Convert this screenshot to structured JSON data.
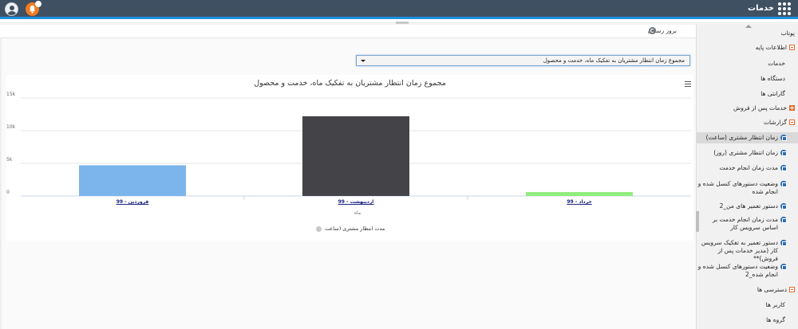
{
  "header": {
    "title": "خدمات",
    "notification_count": ""
  },
  "toolbar": {
    "refresh_label": "بروز رسانی"
  },
  "select": {
    "value": "مجموع زمان انتظار مشتریان به تفکیک ماه، خدمت و محصول"
  },
  "sidebar": {
    "items": [
      {
        "label": "پوتاب",
        "icon": ""
      },
      {
        "label": "اطلاعات پایه",
        "icon": "minus-box-icon"
      },
      {
        "label": "خدمات",
        "icon": ""
      },
      {
        "label": "دستگاه ها",
        "icon": ""
      },
      {
        "label": "گارانتی ها",
        "icon": ""
      },
      {
        "label": "خدمات پس از فروش",
        "icon": "plus-box-icon"
      },
      {
        "label": "گزارشات",
        "icon": "minus-box-icon"
      },
      {
        "label": "زمان انتظار مشتری (ساعت)",
        "icon": "report-icon"
      },
      {
        "label": "زمان انتظار مشتری (روز)",
        "icon": "report-icon"
      },
      {
        "label": "مدت زمان انجام خدمت",
        "icon": "report-icon"
      },
      {
        "label": "وضعیت دستورهای کنسل شده و انجام شده",
        "icon": "report-icon"
      },
      {
        "label": "دستور تعمیر های من_2",
        "icon": "report-icon"
      },
      {
        "label": "مدت زمان انجام خدمت بر اساس سرویس کار",
        "icon": "report-icon"
      },
      {
        "label": "دستور تعمیر به تفکیک سرویس کار (مدیر خدمات پس از فروش)**",
        "icon": "report-icon"
      },
      {
        "label": "وضعیت دستورهای کنسل شده و انجام شده_2",
        "icon": "report-icon"
      },
      {
        "label": "دسترسی ها",
        "icon": "minus-box-icon"
      },
      {
        "label": "کاربر ها",
        "icon": ""
      },
      {
        "label": "گروه ها",
        "icon": ""
      }
    ]
  },
  "colors": {
    "topbar": "#3f5062",
    "accent": "#1e90e0",
    "bell": "#f07b22"
  },
  "chart_data": {
    "type": "bar",
    "title": "مجموع زمان انتظار مشتریان به تفکیک ماه، خدمت و محصول",
    "xlabel": "ماه",
    "ylabel": "",
    "categories": [
      "فروردین - 99",
      "اردیبهشت - 99",
      "خرداد - 99"
    ],
    "values": [
      4700,
      12200,
      600
    ],
    "colors": [
      "#7cb5ec",
      "#434348",
      "#90ed7d"
    ],
    "ylim": [
      0,
      15000
    ],
    "yticks": [
      "0",
      "5k",
      "10k",
      "15k"
    ],
    "grid": true,
    "legend": {
      "position": "bottom",
      "entries": [
        "مدت انتظار مشتری (ساعت"
      ]
    }
  }
}
